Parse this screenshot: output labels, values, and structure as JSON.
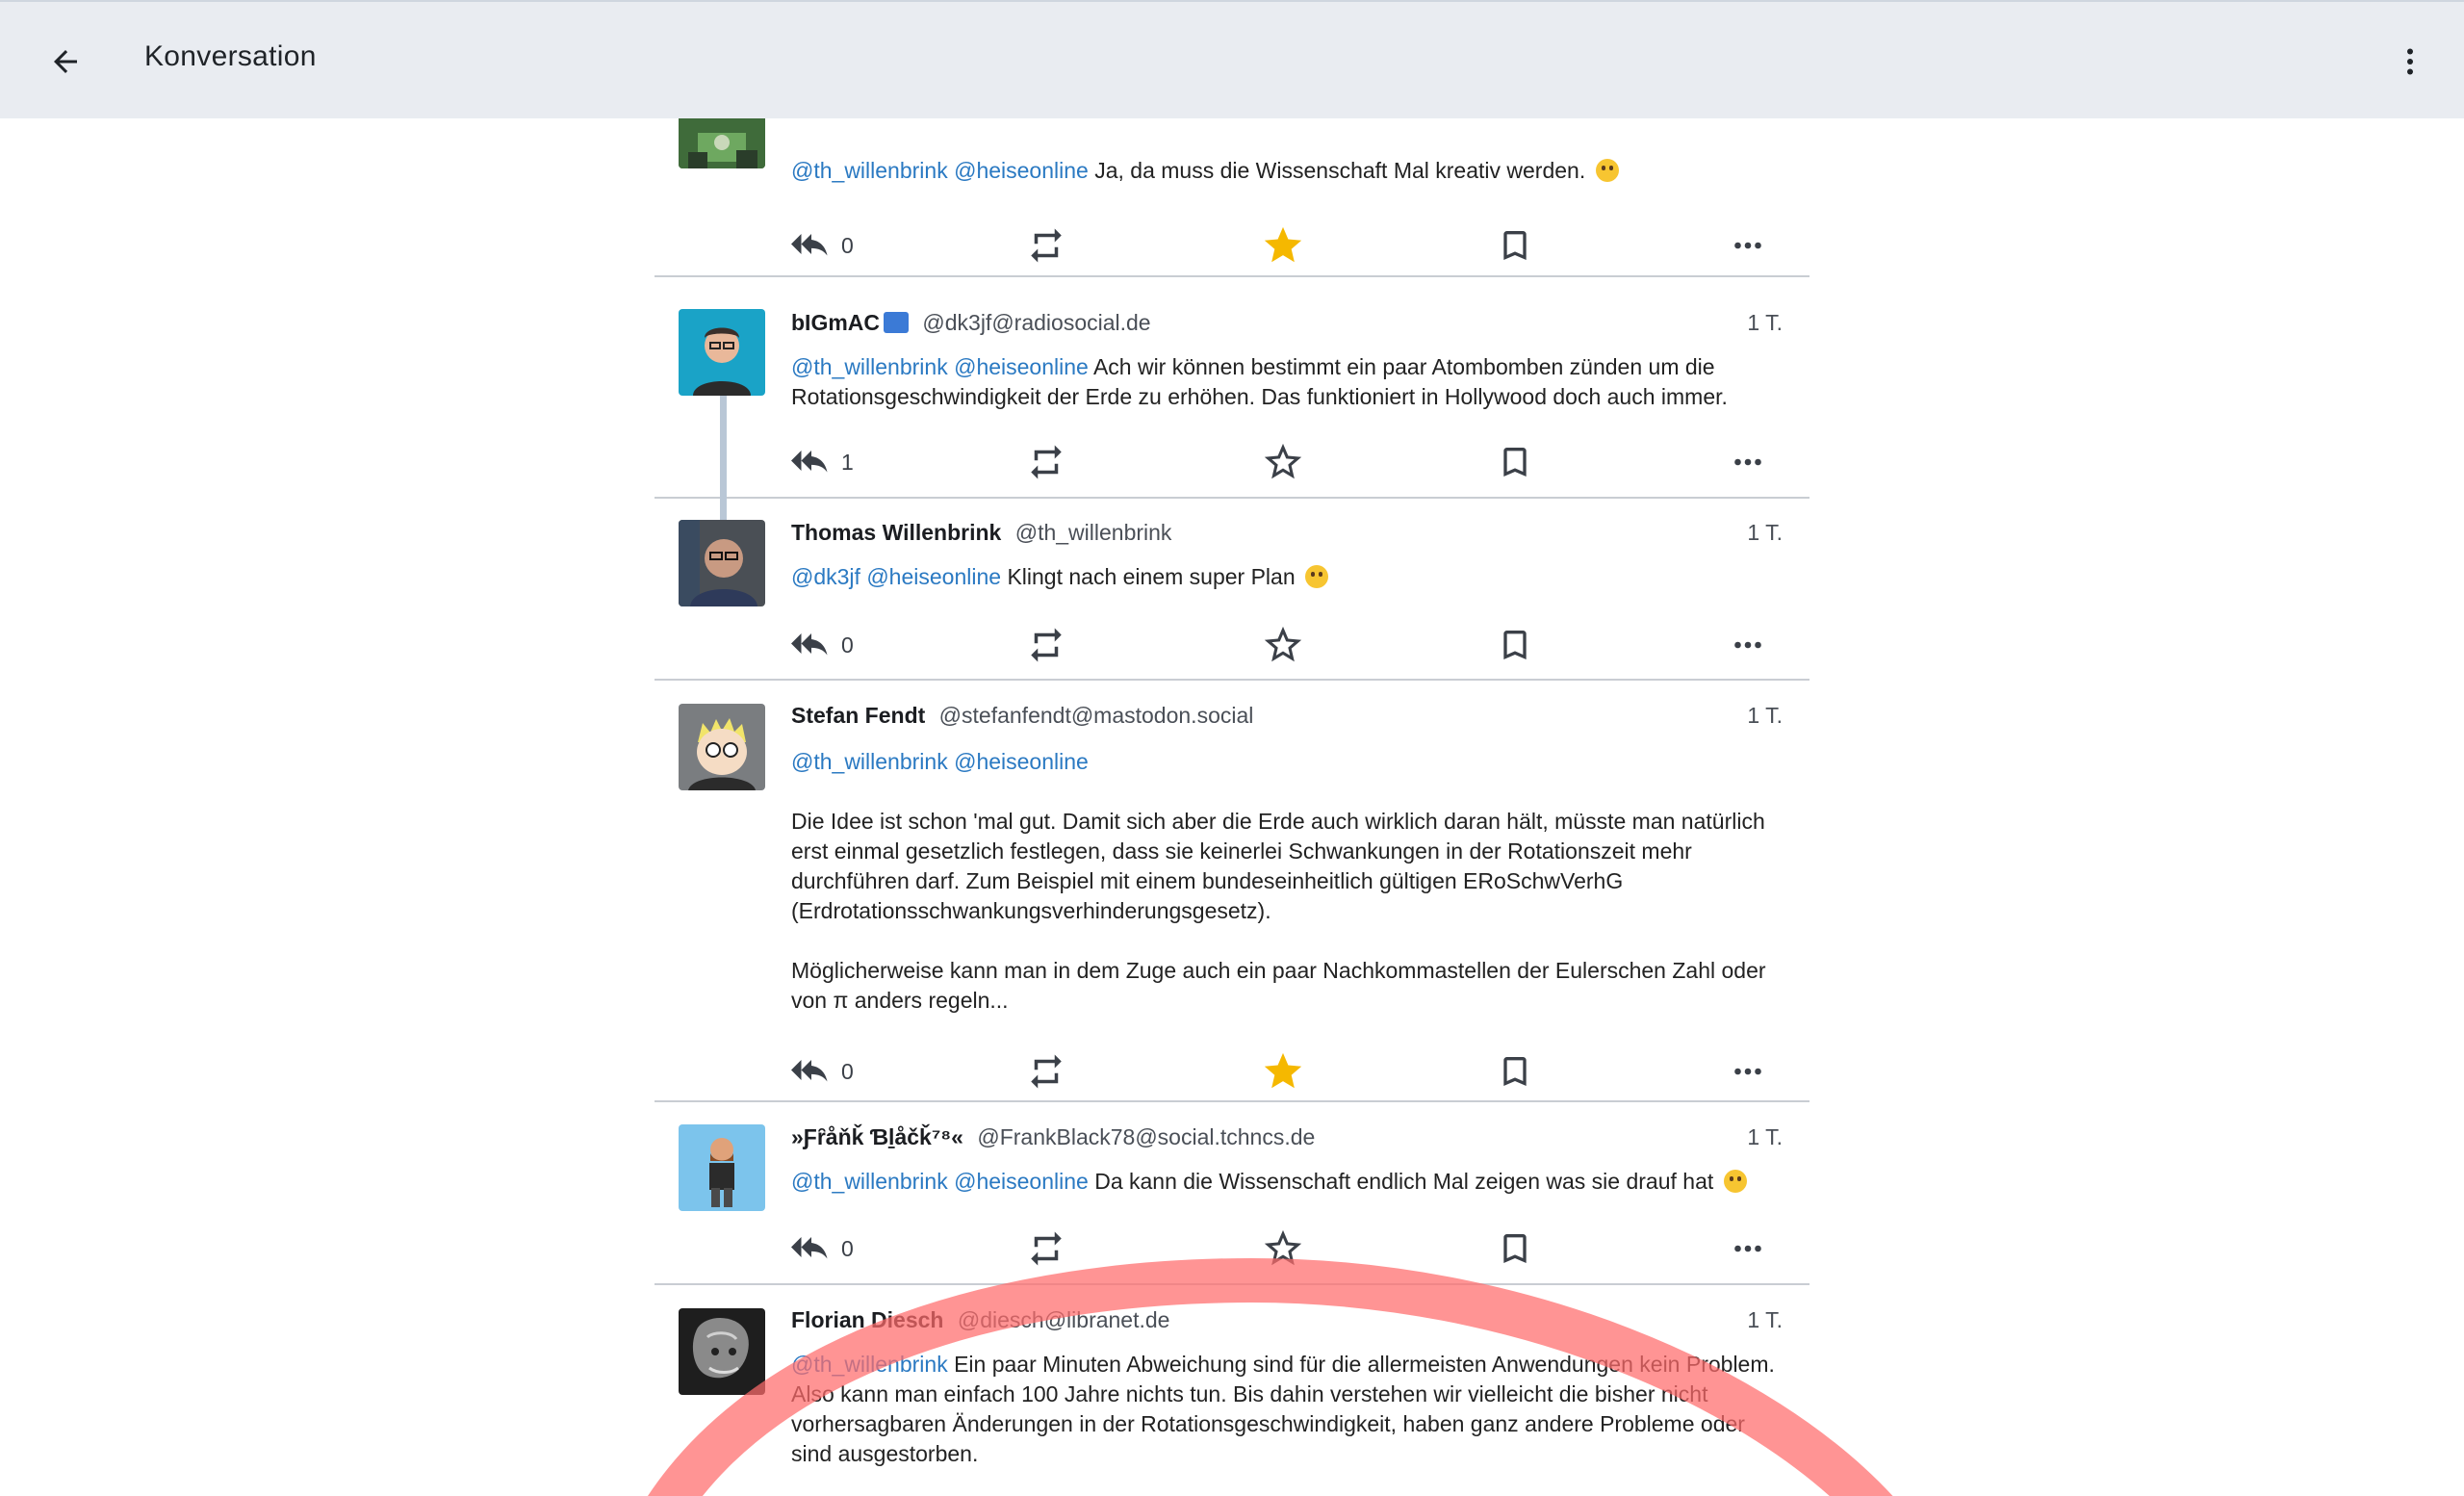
{
  "app_bar": {
    "title": "Konversation",
    "back_icon": "arrow-back-icon",
    "menu_icon": "more-vert-icon"
  },
  "colors": {
    "mention": "#2a79c2",
    "favourite_active": "#f5b800",
    "appbar_bg": "#e9ecf1"
  },
  "statuses": [
    {
      "mentions": [
        "@th_willenbrink",
        "@heiseonline"
      ],
      "text": "Ja, da muss die Wissenschaft Mal kreativ werden.",
      "replies": "0",
      "favourited": true
    },
    {
      "name": "bIGmAC",
      "acct": "@dk3jf@radiosocial.de",
      "time": "1 T.",
      "mentions": [
        "@th_willenbrink",
        "@heiseonline"
      ],
      "text": "Ach wir können bestimmt ein paar Atombomben zünden um die Rotationsgeschwindigkeit der Erde zu erhöhen. Das funktioniert in Hollywood doch auch immer.",
      "replies": "1",
      "favourited": false
    },
    {
      "name": "Thomas Willenbrink",
      "acct": "@th_willenbrink",
      "time": "1 T.",
      "mentions": [
        "@dk3jf",
        "@heiseonline"
      ],
      "text": "Klingt nach einem super Plan",
      "replies": "0",
      "favourited": false
    },
    {
      "name": "Stefan Fendt",
      "acct": "@stefanfendt@mastodon.social",
      "time": "1 T.",
      "mentions": [
        "@th_willenbrink",
        "@heiseonline"
      ],
      "paragraph1": "Die Idee ist schon 'mal gut. Damit sich aber die Erde auch wirklich daran hält, müsste man natürlich erst einmal gesetzlich festlegen, dass sie keinerlei Schwankungen in der Rotationszeit mehr durchführen darf. Zum Beispiel mit einem bundeseinheitlich gültigen ERoSchwVerhG (Erdrotationsschwankungsverhinderungsgesetz).",
      "paragraph2": "Möglicherweise kann man in dem Zuge auch ein paar Nachkommastellen der Eulerschen Zahl oder von π anders regeln...",
      "replies": "0",
      "favourited": true
    },
    {
      "name": "»Ƒȓåňǩ Ɓḻåčǩ⁷⁸«",
      "acct": "@FrankBlack78@social.tchncs.de",
      "time": "1 T.",
      "mentions": [
        "@th_willenbrink",
        "@heiseonline"
      ],
      "text": "Da kann die Wissenschaft endlich Mal zeigen was sie drauf hat",
      "replies": "0",
      "favourited": false
    },
    {
      "name": "Florian Diesch",
      "acct": "@diesch@libranet.de",
      "time": "1 T.",
      "mentions": [
        "@th_willenbrink"
      ],
      "text": "Ein paar Minuten Abweichung sind für die allermeisten Anwendungen kein Problem. Also kann man einfach 100 Jahre nichts tun. Bis dahin verstehen wir vielleicht die bisher nicht vorhersagbaren Änderungen in der Rotationsgeschwindigkeit, haben ganz andere Probleme oder sind ausgestorben."
    }
  ]
}
